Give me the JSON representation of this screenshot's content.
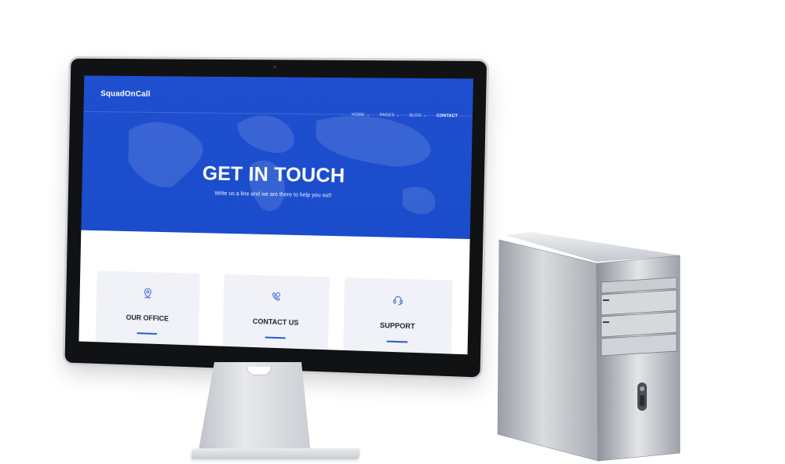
{
  "site": {
    "brand": "SquadOnCall",
    "nav": [
      {
        "label": "HOME",
        "has_caret": true,
        "active": false
      },
      {
        "label": "PAGES",
        "has_caret": true,
        "active": false
      },
      {
        "label": "BLOG",
        "has_caret": true,
        "active": false
      },
      {
        "label": "CONTACT",
        "has_caret": false,
        "active": true
      }
    ],
    "hero": {
      "title": "GET IN TOUCH",
      "subtitle": "Write us a line and we are there to help you out!"
    },
    "cards": [
      {
        "label": "OUR OFFICE",
        "icon": "location-pin-icon"
      },
      {
        "label": "CONTACT US",
        "icon": "phone-chat-icon"
      },
      {
        "label": "SUPPORT",
        "icon": "headset-support-icon"
      }
    ]
  },
  "colors": {
    "hero_blue": "#1a4ccc",
    "card_bg": "#f1f2f7",
    "accent_rule": "#2a59d0",
    "text_dark": "#1d2233"
  },
  "caret_glyph": "⌄"
}
